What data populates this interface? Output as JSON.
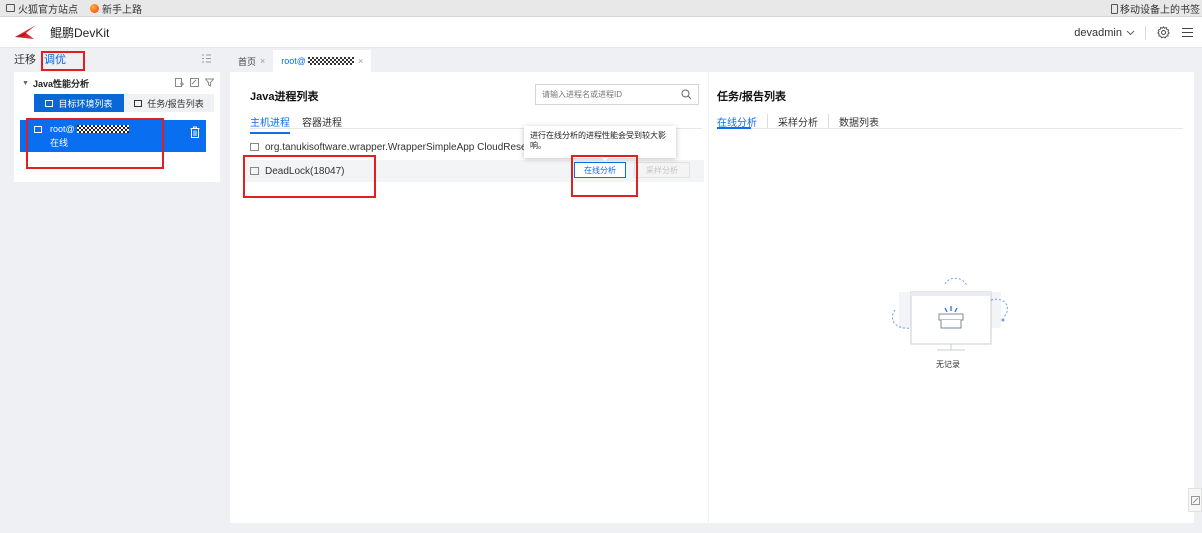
{
  "bookmarks": {
    "official_site": "火狐官方站点",
    "getting_started": "新手上路",
    "mobile_bookmarks": "移动设备上的书签"
  },
  "header": {
    "app_title": "鲲鹏DevKit",
    "user": "devadmin"
  },
  "sidebar": {
    "tabs": [
      "迁移",
      "调优"
    ],
    "active_tab": "调优",
    "tree": {
      "section_title": "Java性能分析",
      "subtabs": [
        "目标环境列表",
        "任务/报告列表"
      ],
      "node": {
        "name_prefix": "root@",
        "status": "在线"
      }
    }
  },
  "page_tabs": [
    {
      "label": "首页",
      "close": "×"
    },
    {
      "label": "root@",
      "close": "×"
    }
  ],
  "main": {
    "title": "Java进程列表",
    "search_placeholder": "请输入进程名或进程ID",
    "tabs": [
      "主机进程",
      "容器进程"
    ],
    "processes": [
      {
        "name": "org.tanukisoftware.wrapper.WrapperSimpleApp CloudResetPwdU"
      },
      {
        "name": "DeadLock(18047)"
      }
    ],
    "tooltip": "进行在线分析的进程性能会受到较大影响。",
    "online_analysis_button": "在线分析",
    "sampling_analysis_button": "采样分析"
  },
  "right": {
    "title": "任务/报告列表",
    "tabs": [
      "在线分析",
      "采样分析",
      "数据列表"
    ],
    "empty_text": "无记录"
  },
  "colors": {
    "accent": "#0a6ef0",
    "annotation": "#e02020"
  }
}
